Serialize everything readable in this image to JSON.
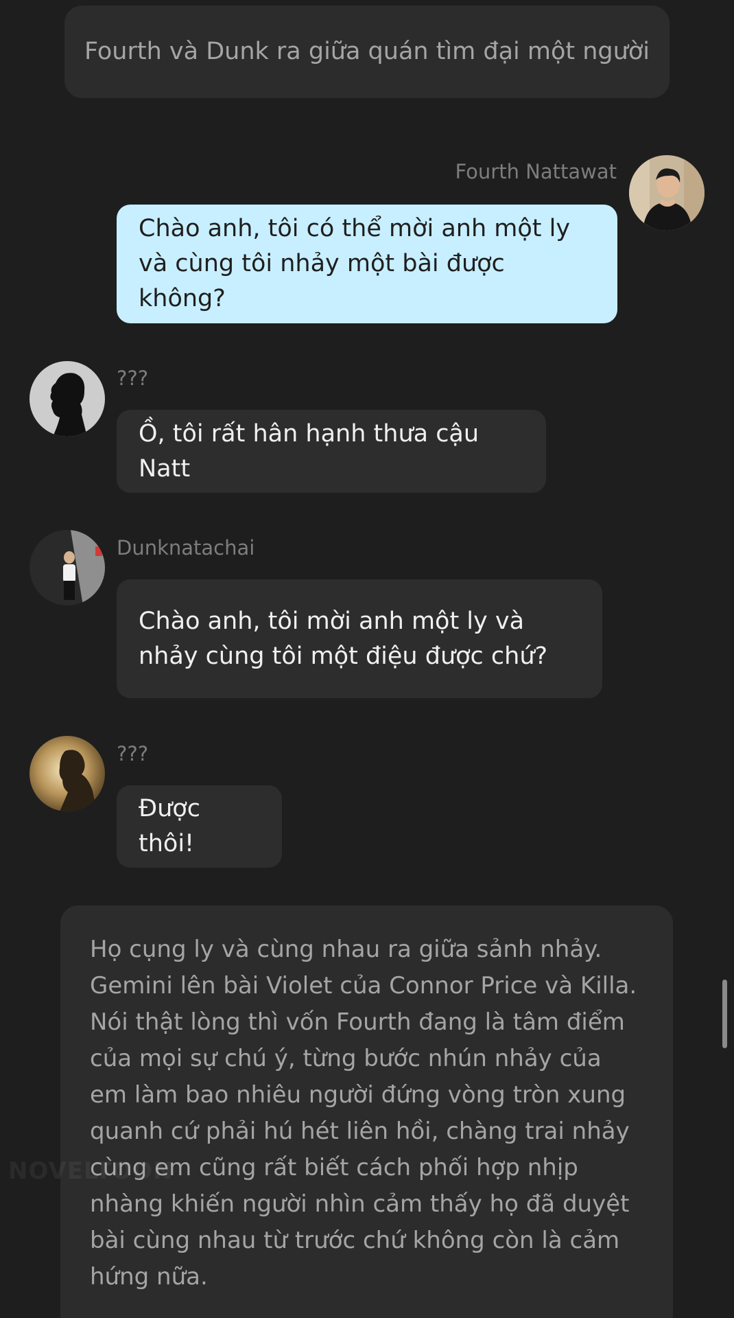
{
  "narration_top": "Fourth và Dunk ra giữa quán tìm đại một người",
  "messages": [
    {
      "sender": "Fourth Nattawat",
      "avatar": "fourth-avatar-photo",
      "text": "Chào anh, tôi có thể mời anh một ly và cùng tôi nhảy một bài được không?",
      "bubble_color": "#c8efff"
    },
    {
      "sender": "???",
      "avatar": "silhouette-avatar-profile",
      "text": "Ồ, tôi rất hân hạnh thưa cậu Natt",
      "bubble_color": "#2d2d2d"
    },
    {
      "sender": "Dunknatachai",
      "avatar": "dunk-avatar-photo",
      "text": "Chào anh, tôi mời anh một ly và nhảy cùng tôi một điệu được chứ?",
      "bubble_color": "#2d2d2d"
    },
    {
      "sender": "???",
      "avatar": "silhouette-avatar-backlit",
      "text": "Được thôi!",
      "bubble_color": "#2d2d2d"
    }
  ],
  "narration_bottom": "Họ cụng ly và cùng nhau ra giữa sảnh nhảy. Gemini lên bài Violet của Connor Price và Killa. Nói thật lòng thì vốn Fourth đang là tâm điểm của mọi sự chú ý, từng bước nhún nhảy của em làm bao nhiêu người đứng vòng tròn xung quanh cứ phải hú hét liên hồi, chàng trai nhảy cùng em cũng rất biết cách phối hợp nhịp nhàng khiến người nhìn cảm thấy họ đã duyệt bài cùng nhau từ trước chứ không còn là cảm hứng nữa.",
  "watermark": "NOVELTOON",
  "colors": {
    "background": "#1e1e1e",
    "narration_bg": "#2c2c2c",
    "own_bubble": "#c8efff",
    "other_bubble": "#2d2d2d"
  }
}
